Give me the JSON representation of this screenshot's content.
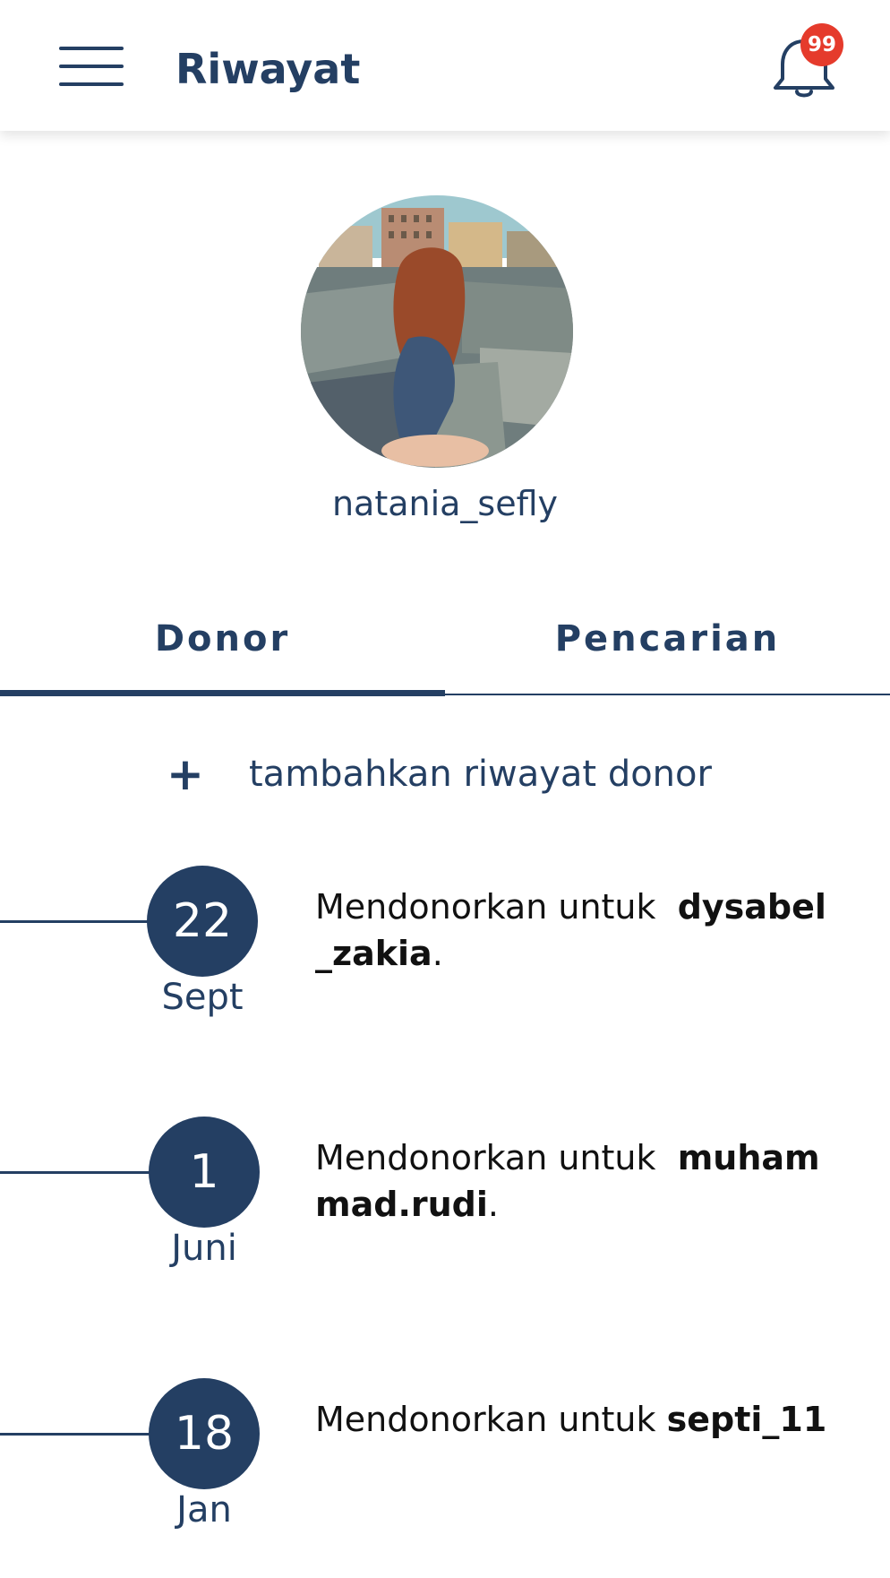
{
  "header": {
    "title": "Riwayat",
    "notification_count": "99"
  },
  "profile": {
    "username": "natania_sefly"
  },
  "tabs": [
    {
      "label": "Donor",
      "active": true
    },
    {
      "label": "Pencarian",
      "active": false
    }
  ],
  "add_history": {
    "icon": "+",
    "label": "tambahkan riwayat donor"
  },
  "history": [
    {
      "day": "22",
      "month": "Sept",
      "text": "Mendonorkan untuk",
      "recipient_line1": "dysabel",
      "recipient_line2": "_zakia",
      "end": "."
    },
    {
      "day": "1",
      "month": "Juni",
      "text": "Mendonorkan untuk",
      "recipient_line1": "muham",
      "recipient_line2": "mad.rudi",
      "end": "."
    },
    {
      "day": "18",
      "month": "Jan",
      "text": "Mendonorkan untuk",
      "recipient_line1": "septi_11",
      "recipient_line2": "",
      "end": ""
    }
  ],
  "colors": {
    "primary": "#243f63",
    "badge": "#e53b2c",
    "background": "#ffffff"
  },
  "icons": {
    "menu": "hamburger-menu-icon",
    "notifications": "bell-icon",
    "add": "plus-icon"
  }
}
